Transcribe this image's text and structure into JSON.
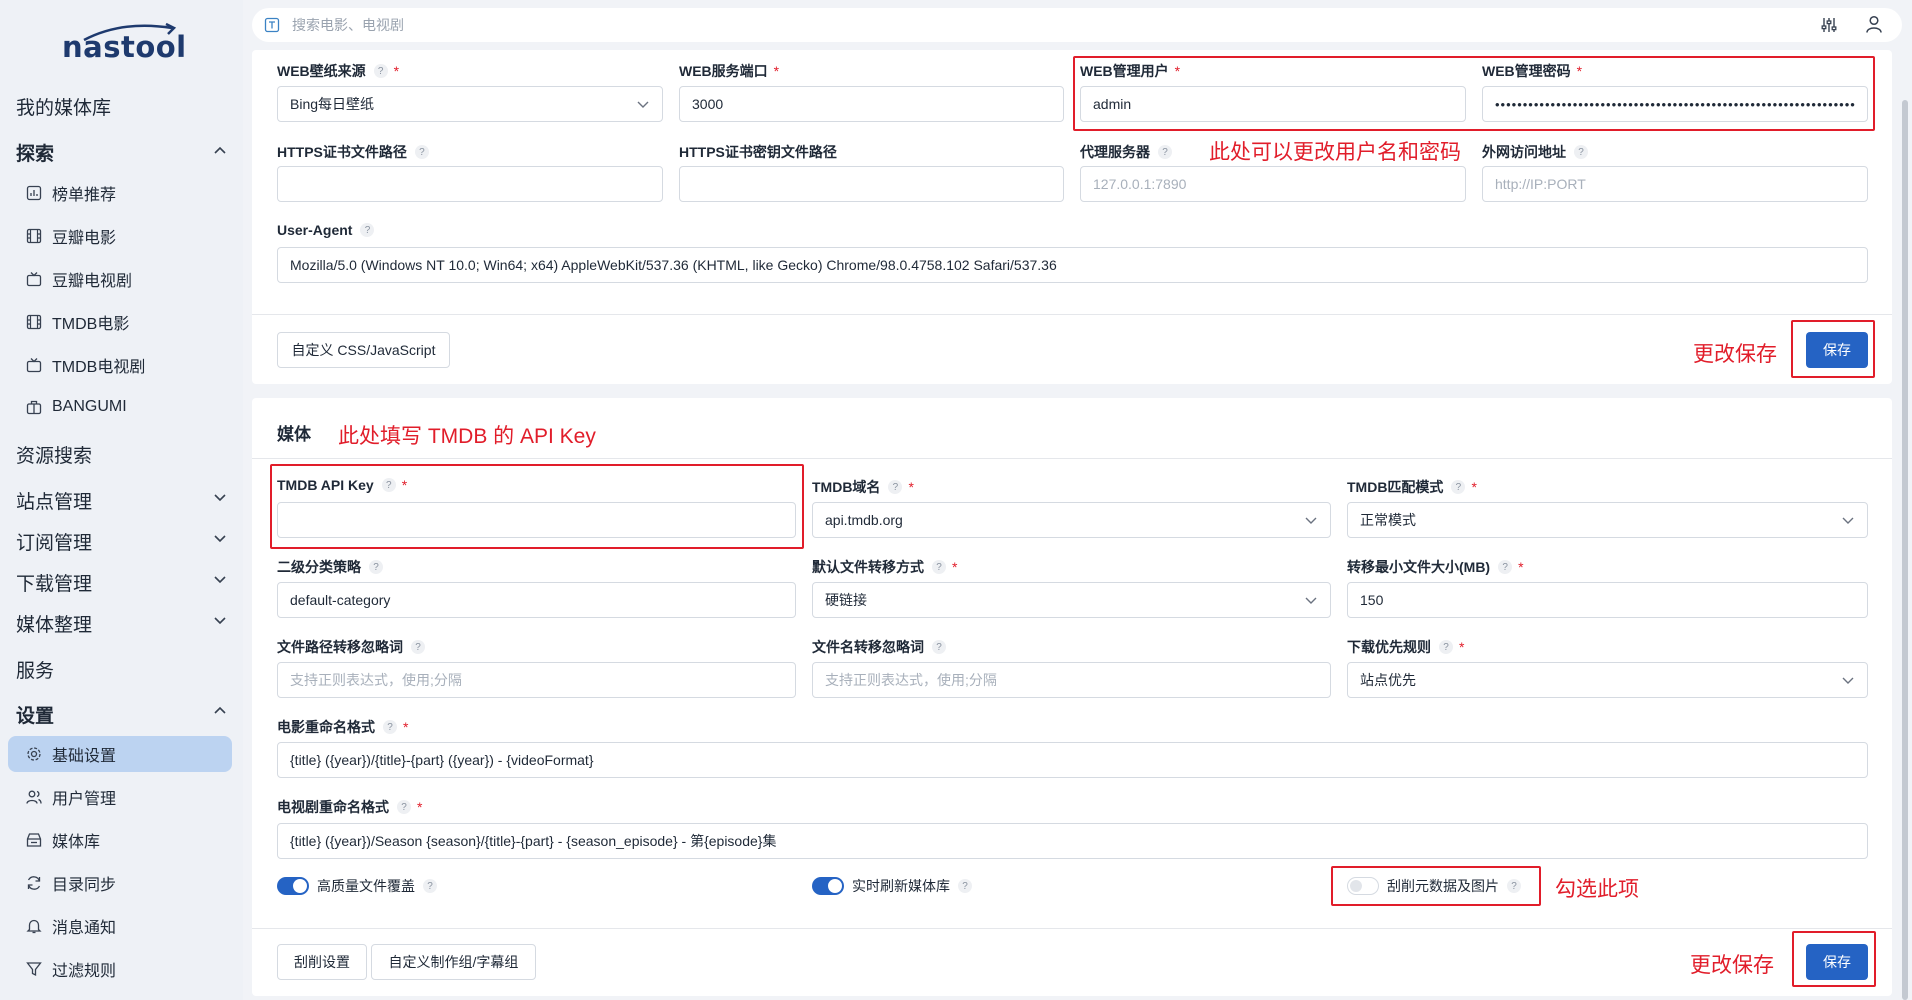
{
  "app": {
    "logo": "nastool"
  },
  "search": {
    "placeholder": "搜索电影、电视剧"
  },
  "sidebar": {
    "library": "我的媒体库",
    "explore": "探索",
    "explore_items": [
      "榜单推荐",
      "豆瓣电影",
      "豆瓣电视剧",
      "TMDB电影",
      "TMDB电视剧",
      "BANGUMI"
    ],
    "resource_search": "资源搜索",
    "site_mgmt": "站点管理",
    "subscribe_mgmt": "订阅管理",
    "download_mgmt": "下载管理",
    "media_org": "媒体整理",
    "service": "服务",
    "settings": "设置",
    "settings_items": [
      "基础设置",
      "用户管理",
      "媒体库",
      "目录同步",
      "消息通知",
      "过滤规则"
    ]
  },
  "web": {
    "wallpaper_label": "WEB壁纸来源",
    "wallpaper_value": "Bing每日壁纸",
    "port_label": "WEB服务端口",
    "port_value": "3000",
    "user_label": "WEB管理用户",
    "user_value": "admin",
    "password_label": "WEB管理密码",
    "password_mask": "•••••••••••••••••••••••••••••••••••••••••••••••••••••••••••••••••••",
    "https_cert_label": "HTTPS证书文件路径",
    "https_key_label": "HTTPS证书密钥文件路径",
    "proxy_label": "代理服务器",
    "proxy_placeholder": "127.0.0.1:7890",
    "external_label": "外网访问地址",
    "external_placeholder": "http://IP:PORT",
    "ua_label": "User-Agent",
    "ua_value": "Mozilla/5.0 (Windows NT 10.0; Win64; x64) AppleWebKit/537.36 (KHTML, like Gecko) Chrome/98.0.4758.102 Safari/537.36",
    "custom_btn": "自定义 CSS/JavaScript",
    "save_btn": "保存"
  },
  "media": {
    "title": "媒体",
    "tmdb_key_label": "TMDB API Key",
    "tmdb_domain_label": "TMDB域名",
    "tmdb_domain_value": "api.tmdb.org",
    "tmdb_match_label": "TMDB匹配模式",
    "tmdb_match_value": "正常模式",
    "category_label": "二级分类策略",
    "category_value": "default-category",
    "transfer_label": "默认文件转移方式",
    "transfer_value": "硬链接",
    "min_size_label": "转移最小文件大小(MB)",
    "min_size_value": "150",
    "path_ignore_label": "文件路径转移忽略词",
    "path_ignore_placeholder": "支持正则表达式，使用;分隔",
    "name_ignore_label": "文件名转移忽略词",
    "name_ignore_placeholder": "支持正则表达式，使用;分隔",
    "download_rule_label": "下载优先规则",
    "download_rule_value": "站点优先",
    "movie_format_label": "电影重命名格式",
    "movie_format_value": "{title} ({year})/{title}-{part} ({year}) - {videoFormat}",
    "tv_format_label": "电视剧重命名格式",
    "tv_format_value": "{title} ({year})/Season {season}/{title}-{part} - {season_episode} - 第{episode}集",
    "hq_overwrite_label": "高质量文件覆盖",
    "hq_overwrite_on": true,
    "refresh_label": "实时刷新媒体库",
    "refresh_on": true,
    "scrape_label": "刮削元数据及图片",
    "scrape_on": false,
    "scrape_btn": "刮削设置",
    "group_btn": "自定义制作组/字幕组",
    "save_btn": "保存"
  },
  "annotations": {
    "user_pw_note": "此处可以更改用户名和密码",
    "save_note_1": "更改保存",
    "tmdb_note": "此处填写 TMDB 的 API Key",
    "scrape_note": "勾选此项",
    "save_note_2": "更改保存"
  },
  "colors": {
    "accent": "#2563c4",
    "annotation": "#e11d2a",
    "active_nav": "#bcd3f1"
  }
}
